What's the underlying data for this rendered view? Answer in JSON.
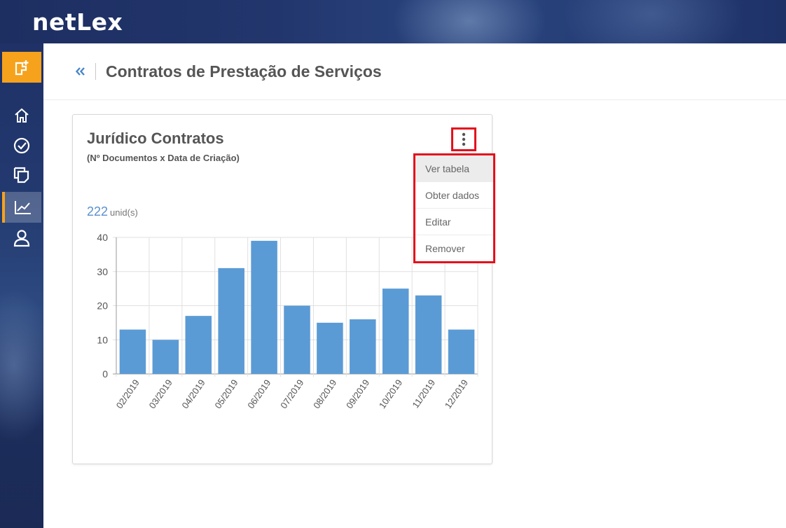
{
  "app": {
    "logo": "netLex"
  },
  "sidebar": {
    "new_button_icon": "new-document-icon",
    "items": [
      {
        "icon": "home-icon",
        "active": false
      },
      {
        "icon": "dashboard-check-icon",
        "active": false
      },
      {
        "icon": "documents-icon",
        "active": false
      },
      {
        "icon": "chart-icon",
        "active": true
      },
      {
        "icon": "user-icon",
        "active": false
      }
    ],
    "accent_color": "#f7a21c"
  },
  "header": {
    "back_icon": "double-chevron-left-icon",
    "title": "Contratos de Prestação de Serviços"
  },
  "card": {
    "title": "Jurídico Contratos",
    "subtitle": "(Nº Documentos x Data de Criação)",
    "metric_value": "222",
    "metric_unit": "unid(s)",
    "menu_icon": "kebab-menu-icon"
  },
  "menu": {
    "items": [
      {
        "label": "Ver tabela",
        "hovered": true
      },
      {
        "label": "Obter dados",
        "hovered": false
      },
      {
        "label": "Editar",
        "hovered": false
      },
      {
        "label": "Remover",
        "hovered": false
      }
    ],
    "highlight_color": "#e3101c"
  },
  "chart_data": {
    "type": "bar",
    "categories": [
      "02/2019",
      "03/2019",
      "04/2019",
      "05/2019",
      "06/2019",
      "07/2019",
      "08/2019",
      "09/2019",
      "10/2019",
      "11/2019",
      "12/2019"
    ],
    "values": [
      13,
      10,
      17,
      31,
      39,
      20,
      15,
      16,
      25,
      23,
      13
    ],
    "ylim": [
      0,
      40
    ],
    "yticks": [
      "0",
      "10",
      "20",
      "30",
      "40"
    ],
    "bar_color": "#5b9bd5",
    "grid": true
  }
}
